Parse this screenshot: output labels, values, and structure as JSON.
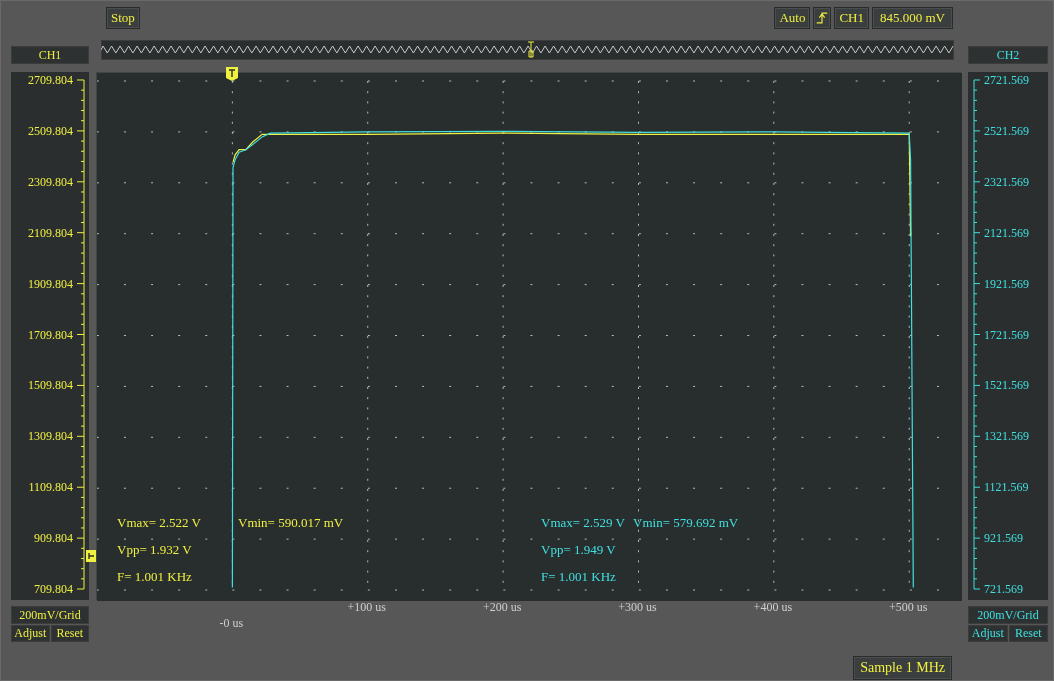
{
  "toolbar": {
    "run_button": "Stop",
    "trigger_mode": "Auto",
    "trigger_rising": true,
    "trigger_source": "CH1",
    "trigger_level": "845.000 mV"
  },
  "ch1_panel": {
    "scale": "200mV/Grid",
    "buttons": [
      "Adjust",
      "Reset"
    ]
  },
  "ch2_panel": {
    "scale_labels": [
      "2721.569",
      "2521.569",
      "2321.569",
      "2121.569",
      "1921.569",
      "1721.569",
      "1521.569",
      "1321.569",
      "1121.569",
      "921.569",
      "721.569"
    ],
    "scale": "200mV/Grid",
    "buttons": [
      "Adjust",
      "Reset"
    ]
  },
  "chart_data": {
    "type": "line",
    "grid": true,
    "x": [
      0,
      0.5,
      2,
      5,
      10,
      15,
      22,
      28,
      100,
      200,
      300,
      400,
      500,
      501,
      503
    ],
    "series": [
      {
        "name": "CH1",
        "color": "#f0f040",
        "values": [
          null,
          2390,
          2420,
          2440,
          2440,
          2470,
          2500,
          2500,
          2500,
          2505,
          2500,
          2500,
          2500,
          2100,
          null
        ]
      },
      {
        "name": "CH2",
        "color": "#40e0e0",
        "values": [
          720,
          2370,
          2400,
          2430,
          2440,
          2460,
          2490,
          2505,
          2510,
          2512,
          2508,
          2510,
          2505,
          2400,
          720
        ]
      }
    ],
    "xlim": [
      -100,
      539
    ],
    "ylim": [
      666.7,
      2741.2
    ],
    "xticks": [
      {
        "value": 100,
        "label": "+100 us"
      },
      {
        "value": 200,
        "label": "+200 us"
      },
      {
        "value": 300,
        "label": "+300 us"
      },
      {
        "value": 400,
        "label": "+400 us"
      },
      {
        "value": 500,
        "label": "+500 us"
      }
    ],
    "yticks": [
      {
        "value": 709.804,
        "label": "709.804"
      },
      {
        "value": 909.804,
        "label": "909.804"
      },
      {
        "value": 1109.804,
        "label": "1109.804"
      },
      {
        "value": 1309.804,
        "label": "1309.804"
      },
      {
        "value": 1509.804,
        "label": "1509.804"
      },
      {
        "value": 1709.804,
        "label": "1709.804"
      },
      {
        "value": 1909.804,
        "label": "1909.804"
      },
      {
        "value": 2109.804,
        "label": "2109.804"
      },
      {
        "value": 2309.804,
        "label": "2309.804"
      },
      {
        "value": 2509.804,
        "label": "2509.804"
      },
      {
        "value": 2709.804,
        "label": "2709.804"
      }
    ]
  },
  "measurements": [
    {
      "color": "#f0f040",
      "vmax": "Vmax= 2.522 V",
      "vmin": "Vmin= 590.017 mV",
      "vpp": "Vpp= 1.932 V",
      "freq": "F= 1.001 KHz"
    },
    {
      "color": "#40e0e0",
      "vmax": "Vmax= 2.529 V",
      "vmin": "Vmin= 579.692 mV",
      "vpp": "Vpp= 1.949 V",
      "freq": "F= 1.001 KHz"
    }
  ],
  "trigger_offset_label": "-0 us",
  "status_bar": {
    "sample_rate": "Sample 1 MHz"
  }
}
